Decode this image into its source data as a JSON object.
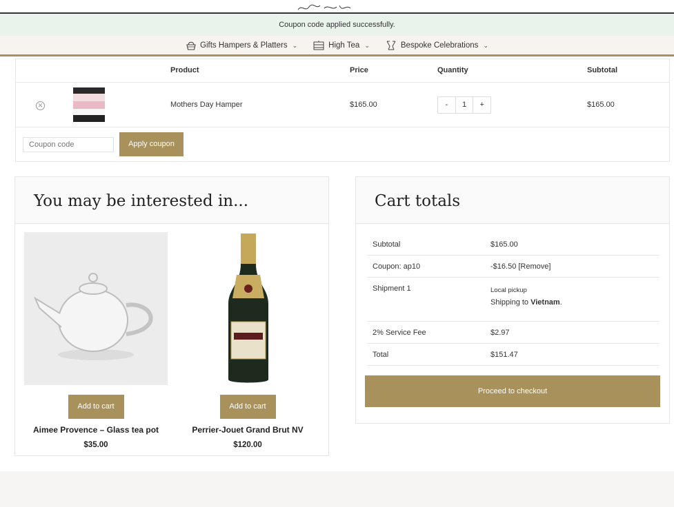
{
  "notice": "Coupon code applied successfully.",
  "nav": [
    {
      "label": "Gifts Hampers & Platters",
      "icon": "hamper-icon"
    },
    {
      "label": "High Tea",
      "icon": "high-tea-icon"
    },
    {
      "label": "Bespoke Celebrations",
      "icon": "glasses-icon"
    }
  ],
  "cart": {
    "headers": {
      "product": "Product",
      "price": "Price",
      "quantity": "Quantity",
      "subtotal": "Subtotal"
    },
    "item": {
      "name": "Mothers Day Hamper",
      "price": "$165.00",
      "qty_minus": "-",
      "qty": "1",
      "qty_plus": "+",
      "subtotal": "$165.00"
    },
    "coupon_placeholder": "Coupon code",
    "apply_label": "Apply coupon"
  },
  "interest": {
    "title": "You may be interested in...",
    "products": [
      {
        "name": "Aimee Provence – Glass tea pot",
        "price": "$35.00",
        "button": "Add to cart"
      },
      {
        "name": "Perrier-Jouet Grand Brut NV",
        "price": "$120.00",
        "button": "Add to cart"
      }
    ]
  },
  "totals": {
    "title": "Cart totals",
    "subtotal_label": "Subtotal",
    "subtotal_value": "$165.00",
    "coupon_label": "Coupon: ap10",
    "coupon_value": "-$16.50",
    "coupon_remove": "[Remove]",
    "shipment_label": "Shipment 1",
    "shipment_method": "Local pickup",
    "shipping_to": "Shipping to",
    "shipping_country": "Vietnam",
    "fee_label": "2% Service Fee",
    "fee_value": "$2.97",
    "total_label": "Total",
    "total_value": "$151.47",
    "checkout_label": "Proceed to checkout"
  },
  "colors": {
    "accent": "#a8915a",
    "notice_bg": "#e9f3ec",
    "header_bg": "#f7f3ee"
  }
}
